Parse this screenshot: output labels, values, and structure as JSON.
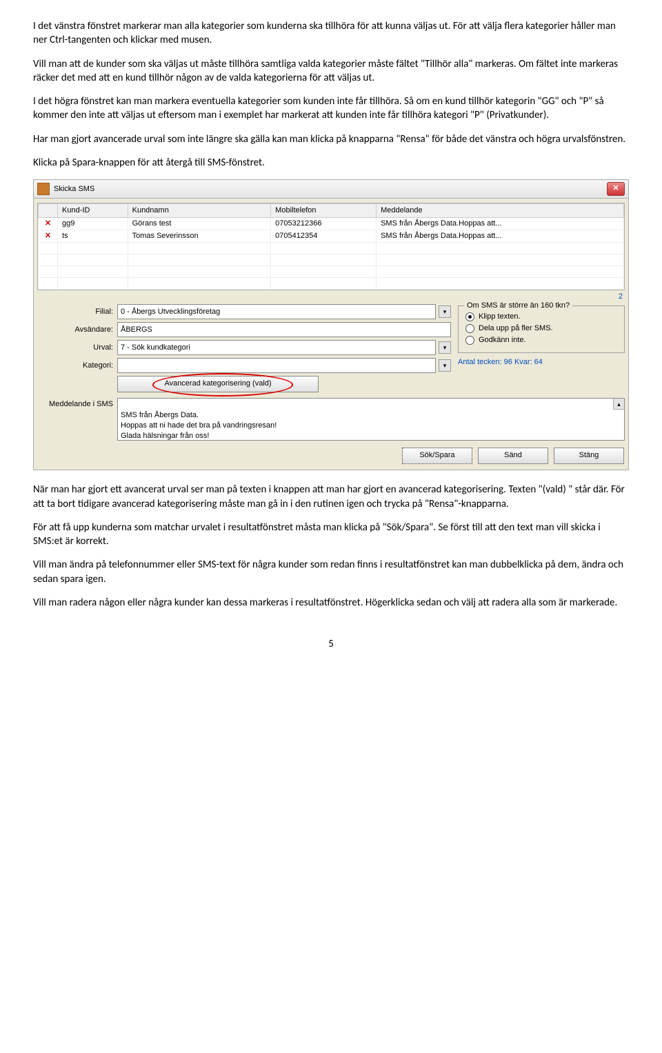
{
  "paragraphs": {
    "p1": "I det vänstra fönstret markerar man alla kategorier som kunderna ska tillhöra för att kunna väljas ut. För att välja flera kategorier håller man ner Ctrl-tangenten och klickar med musen.",
    "p2": "Vill man att de kunder som ska väljas ut måste tillhöra samtliga valda kategorier måste fältet \"Tillhör alla\" markeras. Om fältet inte markeras räcker det med att en kund tillhör någon av de valda kategorierna för att väljas ut.",
    "p3": "I det högra fönstret kan man markera eventuella kategorier som kunden inte får tillhöra. Så om en kund tillhör kategorin \"GG\" och \"P\" så kommer den inte att väljas ut eftersom man i exemplet har markerat att kunden inte får tillhöra kategori \"P\" (Privatkunder).",
    "p4": "Har man gjort avancerade urval som inte längre ska gälla kan man klicka på knapparna \"Rensa\" för både det vänstra och högra urvalsfönstren.",
    "p5": "Klicka på Spara-knappen för att återgå till SMS-fönstret.",
    "p6": "När man har gjort ett avancerat urval ser man på texten i knappen att man har gjort en avancerad kategorisering. Texten \"(vald) \" står där. För att ta bort tidigare avancerad kategorisering måste man gå in i den rutinen igen och trycka på \"Rensa\"-knapparna.",
    "p7": "För att få upp kunderna som matchar urvalet i resultatfönstret måsta man klicka på \"Sök/Spara\". Se först till att den text man vill skicka i SMS:et är korrekt.",
    "p8": "Vill man ändra på telefonnummer eller SMS-text för några kunder som redan finns i resultatfönstret kan man dubbelklicka på dem, ändra och sedan spara igen.",
    "p9": "Vill man radera någon eller några kunder kan dessa markeras i resultatfönstret. Högerklicka sedan och välj att radera alla som är markerade."
  },
  "window": {
    "title": "Skicka SMS",
    "grid_headers": [
      "Kund-ID",
      "Kundnamn",
      "Mobiltelefon",
      "Meddelande"
    ],
    "rows": [
      {
        "x": "✕",
        "id": "gg9",
        "name": "Görans test",
        "tel": "07053212366",
        "msg": "SMS från Åbergs Data.Hoppas att..."
      },
      {
        "x": "✕",
        "id": "ts",
        "name": "Tomas Severinsson",
        "tel": "0705412354",
        "msg": "SMS från Åbergs Data.Hoppas att..."
      }
    ],
    "counter": "2",
    "labels": {
      "filial": "Filial:",
      "avsandare": "Avsändare:",
      "urval": "Urval:",
      "kategori": "Kategori:",
      "meddelande": "Meddelande i SMS"
    },
    "fields": {
      "filial": "0    - Åbergs Utvecklingsföretag",
      "avsandare": "ÅBERGS",
      "urval": "7  - Sök kundkategori",
      "kategori": ""
    },
    "adv_button": "Avancerad kategorisering (vald)",
    "groupbox": {
      "legend": "Om SMS är större än 160 tkn?",
      "r1": "Klipp texten.",
      "r2": "Dela upp på fler SMS.",
      "r3": "Godkänn inte."
    },
    "antal": "Antal tecken: 96 Kvar: 64",
    "message": "SMS från Åbergs Data.\nHoppas att ni hade det bra på vandringsresan!\nGlada hälsningar från oss!",
    "buttons": {
      "sok": "Sök/Spara",
      "sand": "Sänd",
      "stang": "Stäng"
    }
  },
  "page_number": "5"
}
